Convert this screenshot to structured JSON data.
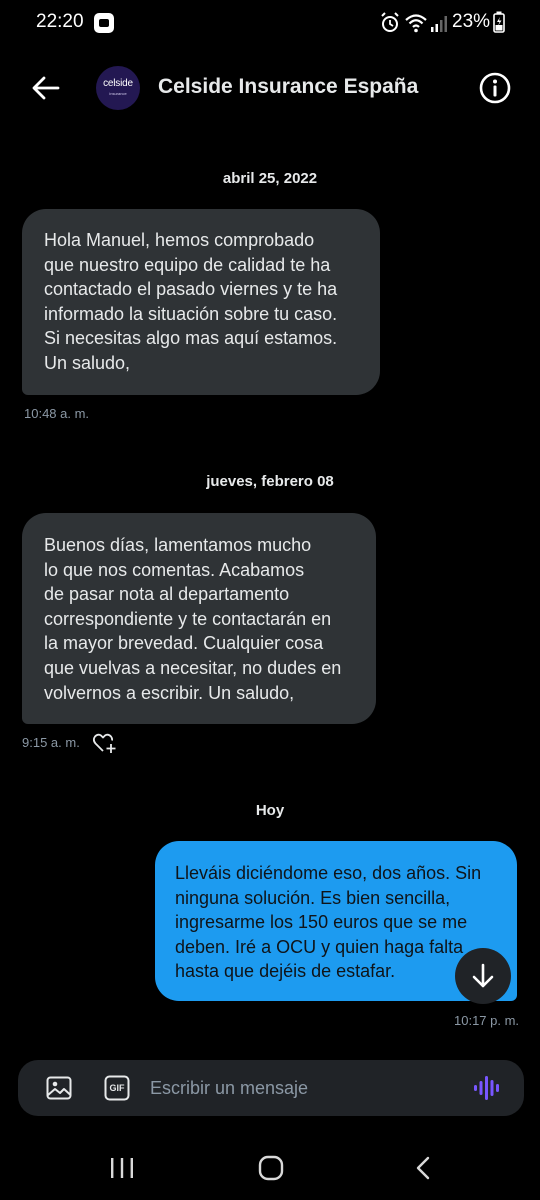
{
  "status_bar": {
    "time": "22:20",
    "battery_percent": "23%"
  },
  "header": {
    "title": "Celside Insurance España",
    "avatar_text": "celside",
    "avatar_subtext": "insurance"
  },
  "messages": [
    {
      "date": "abril 25, 2022",
      "lines": [
        "Hola Manuel, hemos comprobado",
        "que nuestro equipo de calidad te ha",
        "contactado el pasado viernes y te ha",
        "informado la situación sobre tu caso.",
        "Si necesitas algo mas aquí estamos.",
        "Un saludo,"
      ],
      "time": "10:48 a. m.",
      "direction": "incoming"
    },
    {
      "date": "jueves, febrero 08",
      "lines": [
        "Buenos días, lamentamos mucho",
        "lo que nos comentas. Acabamos",
        "de pasar nota al departamento",
        "correspondiente y te contactarán en",
        "la mayor brevedad. Cualquier cosa",
        "que vuelvas a necesitar, no dudes en",
        "volvernos a escribir. Un saludo,"
      ],
      "time": "9:15 a. m.",
      "direction": "incoming"
    },
    {
      "date": "Hoy",
      "lines": [
        "Lleváis diciéndome eso, dos años. Sin",
        "ninguna solución. Es bien sencilla,",
        "ingresarme los 150 euros que se me",
        "deben. Iré a OCU y quien haga falta",
        "hasta que dejéis de estafar."
      ],
      "time": "10:17 p. m.",
      "direction": "outgoing"
    }
  ],
  "composer": {
    "placeholder": "Escribir un mensaje",
    "gif_label": "GIF"
  },
  "colors": {
    "background": "#000000",
    "incoming_bubble": "#2f3336",
    "outgoing_bubble": "#1d9bf0",
    "voice_accent": "#7856ff"
  },
  "icons": [
    "back-arrow-icon",
    "info-icon",
    "add-reaction-icon",
    "arrow-down-icon",
    "image-icon",
    "gif-icon",
    "voice-wave-icon"
  ]
}
